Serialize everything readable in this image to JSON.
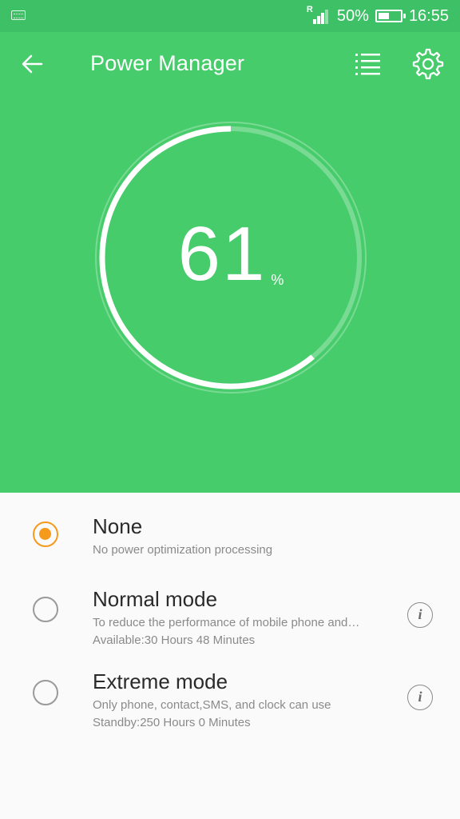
{
  "status_bar": {
    "keyboard_icon": "keyboard-icon",
    "network_indicator": "R",
    "battery_text": "50%",
    "battery_level": 0.5,
    "time": "16:55"
  },
  "app_bar": {
    "title": "Power Manager",
    "back_icon": "back-arrow-icon",
    "list_icon": "list-icon",
    "settings_icon": "gear-icon"
  },
  "gauge": {
    "value": "61",
    "unit": "%",
    "level": 0.61,
    "colors": {
      "background": "#46cc6b",
      "arc": "#ffffff"
    }
  },
  "modes": [
    {
      "name": "None",
      "description": "No power optimization processing",
      "selected": true
    },
    {
      "name": "Normal mode",
      "description": "To reduce the performance of mobile phone and…",
      "detail": "Available:30 Hours 48 Minutes",
      "selected": false
    },
    {
      "name": "Extreme mode",
      "description": "Only phone, contact,SMS, and clock can use",
      "detail": "Standby:250 Hours 0 Minutes",
      "selected": false
    }
  ],
  "colors": {
    "accent": "#f59a1a",
    "status_bar": "#3ec166",
    "header": "#46cc6b"
  }
}
